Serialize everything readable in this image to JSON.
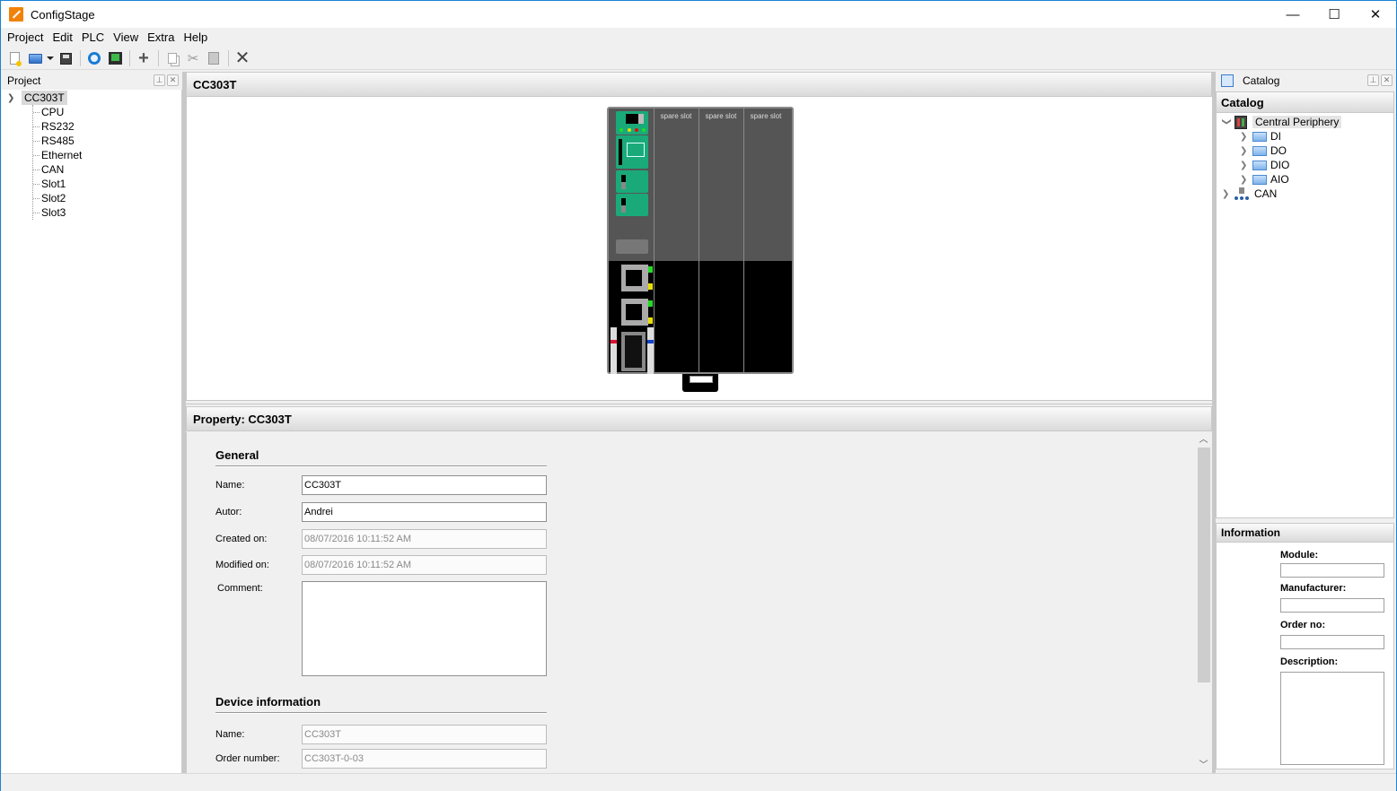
{
  "window": {
    "title": "ConfigStage",
    "controls": {
      "minimize": "—",
      "maximize": "☐",
      "close": "✕"
    }
  },
  "menu": [
    "Project",
    "Edit",
    "PLC",
    "View",
    "Extra",
    "Help"
  ],
  "toolbar": {
    "buttons": [
      "new-file",
      "open-file",
      "open-dropdown",
      "save",
      "compile",
      "download",
      "add",
      "copy",
      "cut",
      "paste",
      "delete"
    ],
    "add_symbol": "+",
    "delete_symbol": "✕",
    "cut_symbol": "✂"
  },
  "project_panel": {
    "title": "Project",
    "pin": "⊥",
    "close": "✕",
    "tree": {
      "root": "CC303T",
      "expanded": true,
      "children": [
        "CPU",
        "RS232",
        "RS485",
        "Ethernet",
        "CAN",
        "Slot1",
        "Slot2",
        "Slot3"
      ]
    }
  },
  "device_view": {
    "title": "CC303T",
    "slots": [
      "spare slot",
      "spare slot",
      "spare slot"
    ],
    "led_colors": {
      "green": "#22dd22",
      "yellow": "#e8e000",
      "red": "#dd1111",
      "blue": "#1144cc"
    }
  },
  "property": {
    "title": "Property: CC303T",
    "general": {
      "heading": "General",
      "fields": [
        {
          "label": "Name:",
          "value": "CC303T",
          "readonly": false
        },
        {
          "label": "Autor:",
          "value": "Andrei",
          "readonly": false
        },
        {
          "label": "Created on:",
          "value": "08/07/2016 10:11:52 AM",
          "readonly": true
        },
        {
          "label": "Modified on:",
          "value": "08/07/2016 10:11:52 AM",
          "readonly": true
        }
      ],
      "comment_label": "Comment:",
      "comment_value": ""
    },
    "device_info": {
      "heading": "Device information",
      "fields": [
        {
          "label": "Name:",
          "value": "CC303T",
          "readonly": true
        },
        {
          "label": "Order number:",
          "value": "CC303T-0-03",
          "readonly": true
        }
      ]
    },
    "scroll": {
      "up": "︿",
      "down": "﹀"
    }
  },
  "catalog_panel": {
    "title": "Catalog",
    "subheader": "Catalog",
    "tree": [
      {
        "label": "Central Periphery",
        "expanded": true,
        "selected": true,
        "children": [
          "DI",
          "DO",
          "DIO",
          "AIO"
        ]
      },
      {
        "label": "CAN",
        "expanded": false
      }
    ]
  },
  "information_panel": {
    "title": "Information",
    "fields": [
      {
        "label": "Module:",
        "value": ""
      },
      {
        "label": "Manufacturer:",
        "value": ""
      },
      {
        "label": "Order no:",
        "value": ""
      },
      {
        "label": "Description:",
        "value": ""
      }
    ]
  }
}
